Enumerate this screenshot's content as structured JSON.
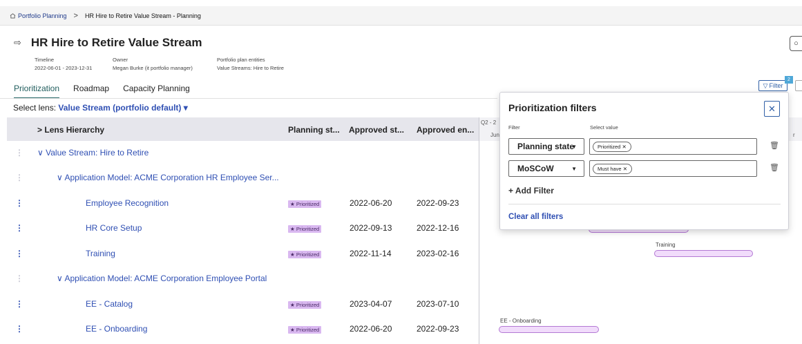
{
  "breadcrumb": {
    "root": "Portfolio Planning",
    "separator": ">",
    "current": "HR Hire to Retire Value Stream - Planning"
  },
  "header": {
    "title": "HR Hire to Retire Value Stream",
    "timeline_label": "Timeline",
    "timeline_value": "2022-06-01 - 2023-12-31",
    "owner_label": "Owner",
    "owner_value": "Megan Burke (it portfolio manager)",
    "entities_label": "Portfolio plan entities",
    "entities_value": "Value Streams: Hire to Retire"
  },
  "tabs": [
    "Prioritization",
    "Roadmap",
    "Capacity Planning"
  ],
  "toolbar": {
    "filter_label": "Filter",
    "filter_count": "2"
  },
  "lens": {
    "label": "Select lens:",
    "value": "Value Stream (portfolio default)"
  },
  "table": {
    "headers": [
      "Lens Hierarchy",
      "Planning st...",
      "Approved st...",
      "Approved en..."
    ],
    "rows": [
      {
        "name": "Value Stream: Hire to Retire"
      },
      {
        "name": "Application Model: ACME Corporation HR Employee Ser..."
      },
      {
        "name": "Employee Recognition",
        "state": "Prioritized",
        "start": "2022-06-20",
        "end": "2022-09-23"
      },
      {
        "name": "HR Core Setup",
        "state": "Prioritized",
        "start": "2022-09-13",
        "end": "2022-12-16"
      },
      {
        "name": "Training",
        "state": "Prioritized",
        "start": "2022-11-14",
        "end": "2023-02-16"
      },
      {
        "name": "Application Model: ACME Corporation Employee Portal"
      },
      {
        "name": "EE - Catalog",
        "state": "Prioritized",
        "start": "2023-04-07",
        "end": "2023-07-10"
      },
      {
        "name": "EE - Onboarding",
        "state": "Prioritized",
        "start": "2022-06-20",
        "end": "2022-09-23"
      }
    ]
  },
  "gantt": {
    "period_label": "Q2 - 2",
    "month_label": "Jun",
    "edge_label": "r",
    "bar_labels": [
      "Training",
      "EE - Onboarding"
    ]
  },
  "filters_panel": {
    "title": "Prioritization filters",
    "filter_header": "Filter",
    "value_header": "Select value",
    "filters": [
      {
        "field": "Planning state",
        "value": "Prioritized"
      },
      {
        "field": "MoSCoW",
        "value": "Must have"
      }
    ],
    "add_label": "Add Filter",
    "clear_label": "Clear all filters"
  }
}
